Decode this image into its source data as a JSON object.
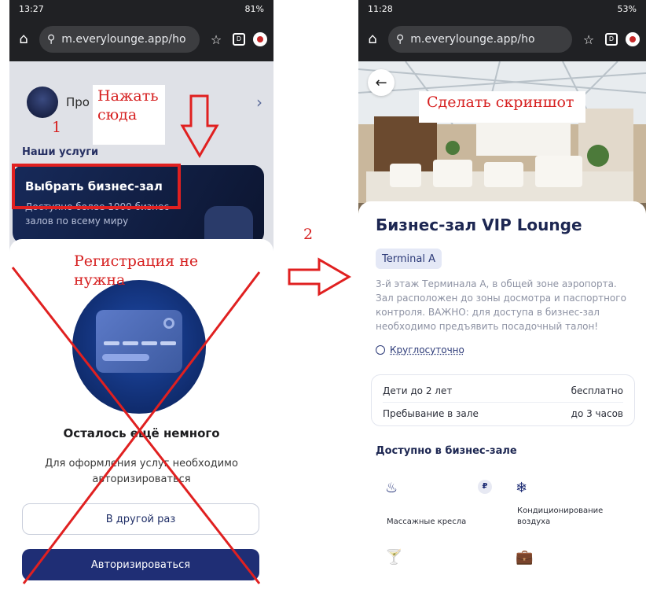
{
  "left_phone": {
    "status": {
      "time": "13:27",
      "battery": "81%"
    },
    "browser": {
      "url": "m.everylounge.app/ho"
    },
    "profile": {
      "label": "Про"
    },
    "services_label": "Наши услуги",
    "lounge_card": {
      "title": "Выбрать бизнес-зал",
      "subtitle": "Доступно более 1000 бизнес-залов по всему миру"
    },
    "sheet": {
      "title": "Осталось ещё немного",
      "description": "Для оформления услуг необходимо авторизироваться",
      "later_button": "В другой раз",
      "auth_button": "Авторизироваться"
    }
  },
  "annotations": {
    "click_here": "Нажать сюда",
    "step1": "1",
    "step2": "2",
    "no_registration": "Регистрация не нужна",
    "take_screenshot": "Сделать скриншот"
  },
  "right_phone": {
    "status": {
      "time": "11:28",
      "battery": "53%"
    },
    "browser": {
      "url": "m.everylounge.app/ho"
    },
    "title": "Бизнес-зал VIP Lounge",
    "terminal": "Terminal A",
    "description": "3-й этаж Терминала А, в общей зоне аэропорта. Зал расположен до зоны досмотра и паспортного контроля. ВАЖНО: для доступа в бизнес-зал необходимо предъявить посадочный талон!",
    "hours": "Круглосуточно",
    "info_rows": [
      {
        "label": "Дети до 2 лет",
        "value": "бесплатно"
      },
      {
        "label": "Пребывание в зале",
        "value": "до 3 часов"
      }
    ],
    "available_label": "Доступно в бизнес-зале",
    "amenities": [
      {
        "label": "Массажные кресла",
        "icon": "massage-chair-icon",
        "badge": "₽"
      },
      {
        "label": "Кондиционирование воздуха",
        "icon": "snowflake-icon"
      },
      {
        "label": "",
        "icon": "cocktail-icon"
      },
      {
        "label": "",
        "icon": "briefcase-icon"
      }
    ]
  },
  "colors": {
    "annotation_red": "#e02020",
    "primary_navy": "#1f2e75"
  }
}
